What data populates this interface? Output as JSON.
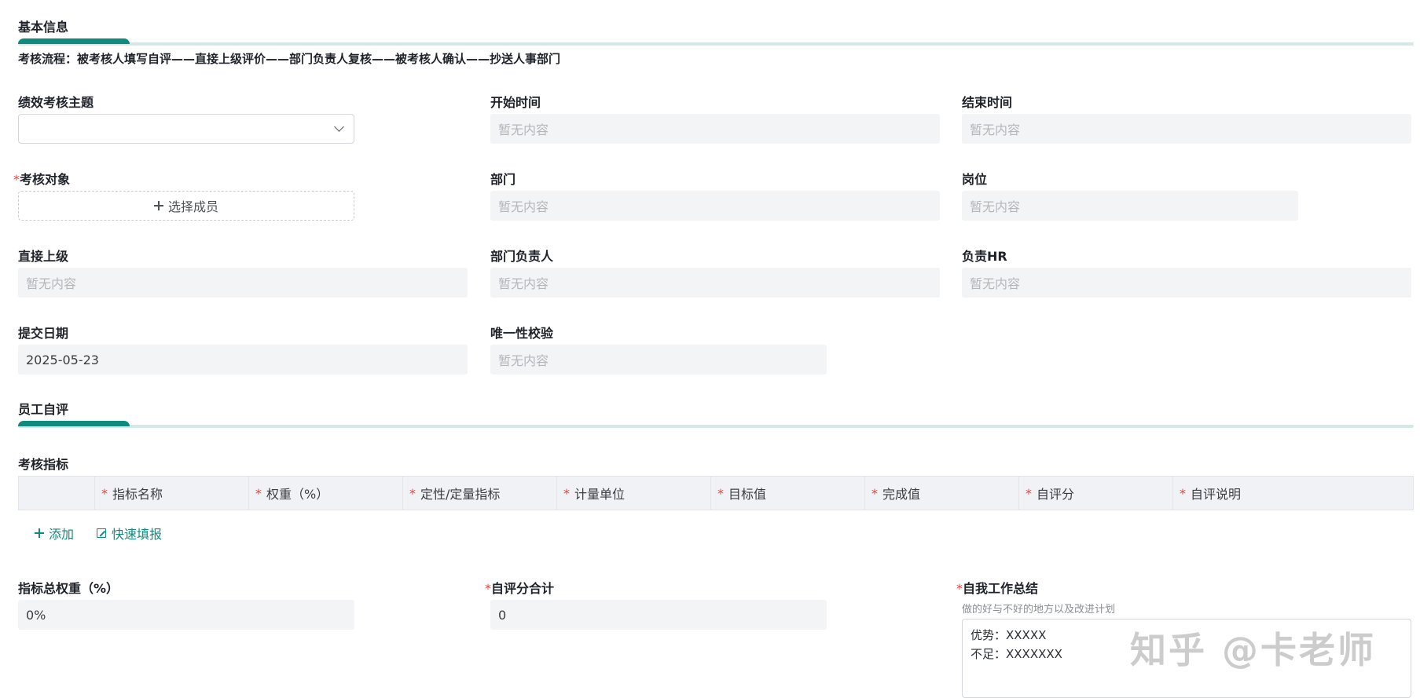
{
  "basic_info": {
    "title": "基本信息",
    "flow": "考核流程：被考核人填写自评——直接上级评价——部门负责人复核——被考核人确认——抄送人事部门"
  },
  "fields": {
    "theme": {
      "label": "绩效考核主题",
      "value": ""
    },
    "start_time": {
      "label": "开始时间",
      "placeholder": "暂无内容"
    },
    "end_time": {
      "label": "结束时间",
      "placeholder": "暂无内容"
    },
    "target": {
      "label": "考核对象",
      "button": "选择成员"
    },
    "department": {
      "label": "部门",
      "placeholder": "暂无内容"
    },
    "position": {
      "label": "岗位",
      "placeholder": "暂无内容"
    },
    "supervisor": {
      "label": "直接上级",
      "placeholder": "暂无内容"
    },
    "dept_head": {
      "label": "部门负责人",
      "placeholder": "暂无内容"
    },
    "hr": {
      "label": "负责HR",
      "placeholder": "暂无内容"
    },
    "submit_date": {
      "label": "提交日期",
      "value": "2025-05-23"
    },
    "unique_check": {
      "label": "唯一性校验",
      "placeholder": "暂无内容"
    }
  },
  "self_eval": {
    "title": "员工自评",
    "indicators_label": "考核指标",
    "columns": [
      "指标名称",
      "权重（%）",
      "定性/定量指标",
      "计量单位",
      "目标值",
      "完成值",
      "自评分",
      "自评说明"
    ],
    "add_label": "添加",
    "quick_fill_label": "快速填报",
    "total_weight": {
      "label": "指标总权重（%）",
      "value": "0%"
    },
    "total_score": {
      "label": "自评分合计",
      "value": "0"
    },
    "summary": {
      "label": "自我工作总结",
      "hint": "做的好与不好的地方以及改进计划",
      "line1": "优势：XXXXX",
      "line2": "不足：XXXXXXX"
    }
  },
  "watermark": "知乎 @卡老师",
  "colors": {
    "accent": "#0f8a7f",
    "required": "#e0473d",
    "field_bg": "#f3f4f6"
  }
}
